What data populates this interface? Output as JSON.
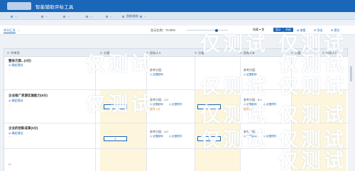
{
  "app": {
    "title": "智能辅助评标工具"
  },
  "tabs": [
    {
      "label": "..."
    },
    {
      "label": "..."
    },
    {
      "label": "..."
    },
    {
      "label": "..."
    },
    {
      "label": "..."
    },
    {
      "label": "智能辅助"
    },
    {
      "label": "..."
    }
  ],
  "toolbar": {
    "crumb": "评分汇总",
    "crumb2": "...",
    "zoom_label": "显示比例：",
    "zoom_value": "73.00%",
    "mode": "隐藏 ▾ 更",
    "btn1": "显示",
    "btn2": "关闭",
    "icon1": "⊞ 查看",
    "icon2": "⊟ 导出",
    "icon3": "✉ 提交"
  },
  "columns": [
    {
      "label": "评审项"
    },
    {
      "label": "分值"
    },
    {
      "label": "投标人A"
    },
    {
      "label": "分值"
    },
    {
      "label": "投标人B"
    },
    {
      "label": "分值"
    },
    {
      "label": "投标人C"
    }
  ],
  "sections": [
    {
      "title": "整体方案...(3分)",
      "link": "◎ 确定建议",
      "text": "..."
    },
    {
      "title": "企业推广资源实施能力(8分)",
      "link": "◎ 确定建议",
      "text": "..."
    },
    {
      "title": "企业的创新成果(5分)",
      "link": "◎ 确定建议",
      "text": "..."
    },
    {
      "title": "..."
    }
  ],
  "refs": {
    "label": "参考分值：",
    "sub1": "◎ 证据影响",
    "sub2": "◎ 证据附件",
    "score_a": "1.0",
    "score_b": "8.0",
    "score_c": "4.0",
    "rec_a": "推荐 1分",
    "rec_b": "推荐 3分",
    "box_a": "1",
    "box_b": "1",
    "box_c": "4",
    "box_d": "4"
  },
  "watermark": "仅测试"
}
